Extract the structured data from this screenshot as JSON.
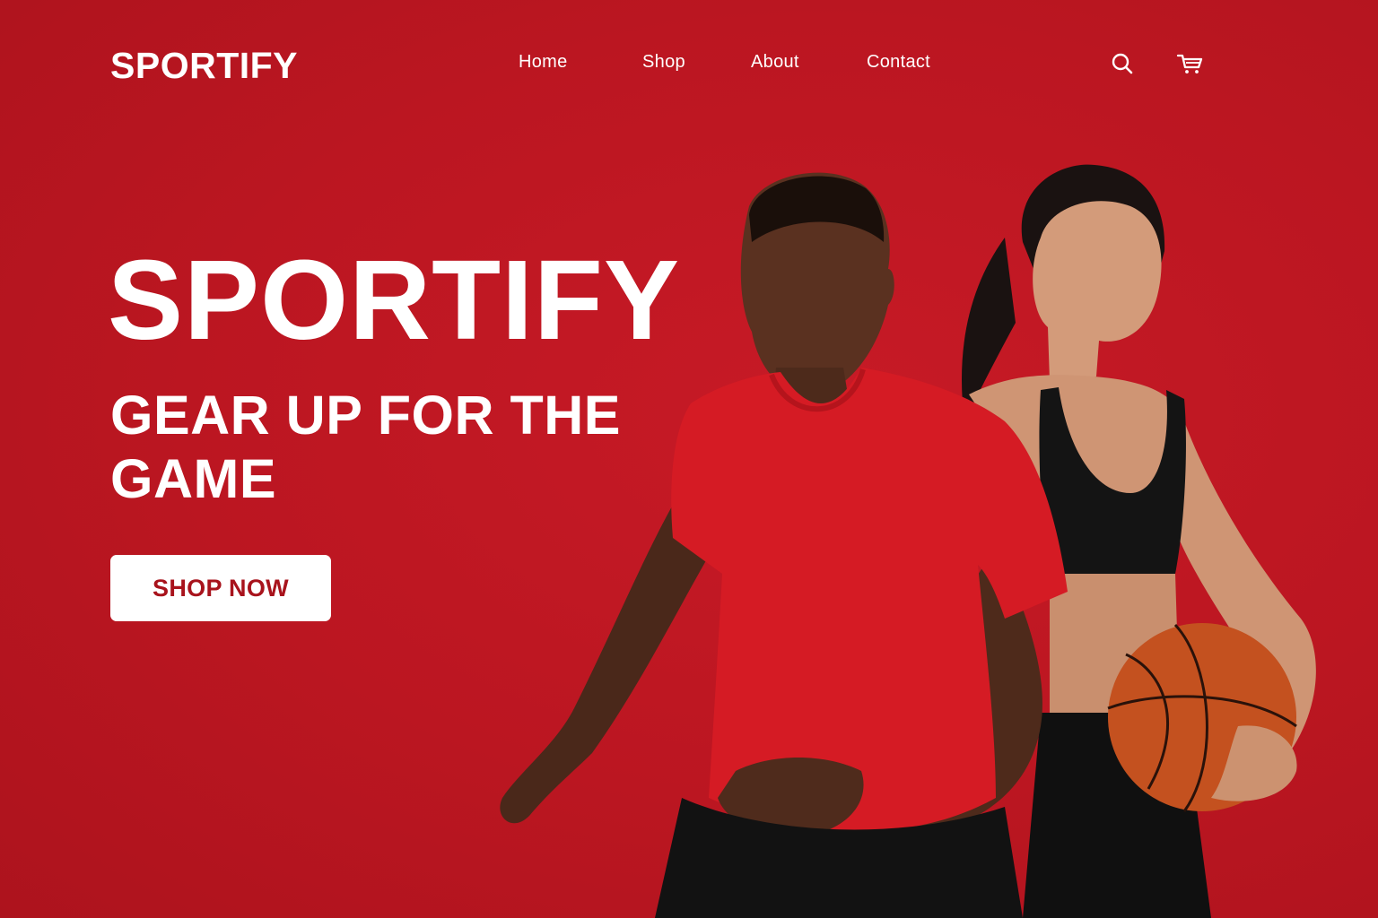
{
  "header": {
    "logo": "SPORTIFY",
    "nav": {
      "home": "Home",
      "shop": "Shop",
      "about": "About",
      "contact": "Contact"
    },
    "icons": [
      "search-icon",
      "cart-icon"
    ]
  },
  "hero": {
    "title": "SPORTIFY",
    "subtitle": "GEAR UP FOR THE GAME",
    "cta_label": "SHOP NOW",
    "image": "two athletes: man in red t-shirt dribbling, woman in black sports top holding a basketball"
  },
  "colors": {
    "background": "#bd1722",
    "text": "#ffffff",
    "button_bg": "#ffffff",
    "button_text": "#a8131c",
    "ball": "#c4511f"
  }
}
